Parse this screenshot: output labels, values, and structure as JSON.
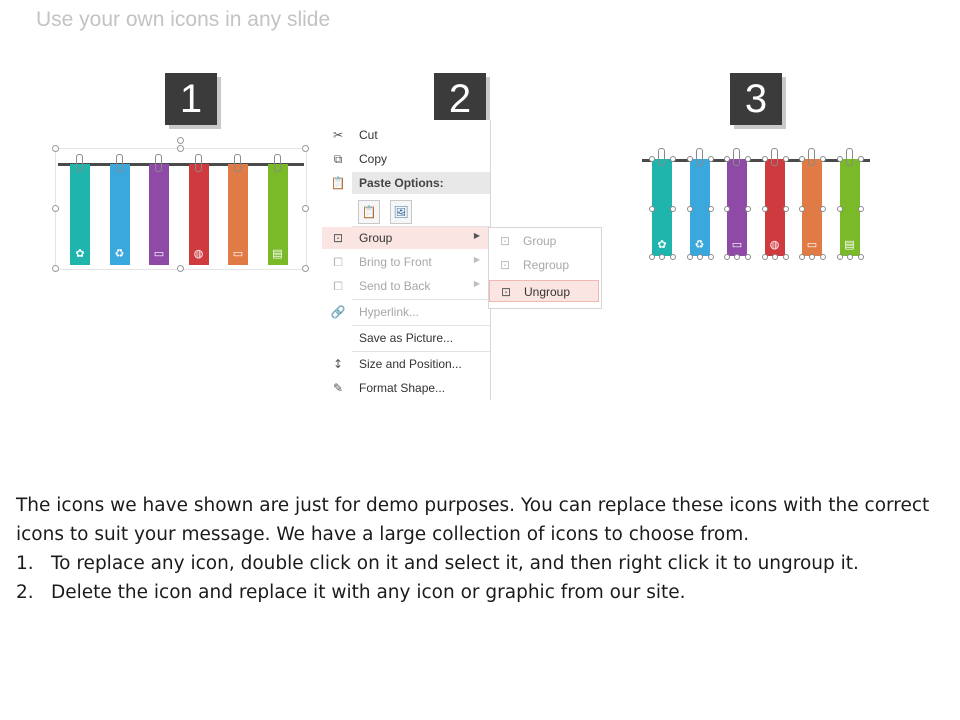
{
  "slide": {
    "title": "Use your own icons in any slide"
  },
  "steps": [
    "1",
    "2",
    "3"
  ],
  "banners": [
    {
      "color": "#1fb5ad",
      "icon": "hand-plant-icon",
      "glyph": "✿"
    },
    {
      "color": "#3aa8dc",
      "icon": "recycle-icon",
      "glyph": "♻"
    },
    {
      "color": "#8e4aa6",
      "icon": "billboard-icon",
      "glyph": "▭"
    },
    {
      "color": "#cf3a3f",
      "icon": "globe-icon",
      "glyph": "◍"
    },
    {
      "color": "#e07b45",
      "icon": "battery-icon",
      "glyph": "▭"
    },
    {
      "color": "#7ab928",
      "icon": "document-icon",
      "glyph": "▤"
    }
  ],
  "context_menu": {
    "items": [
      {
        "label": "Cut",
        "icon": "scissors-icon",
        "glyph": "✂",
        "disabled": false
      },
      {
        "label": "Copy",
        "icon": "copy-icon",
        "glyph": "⧉",
        "disabled": false
      },
      {
        "label": "Paste Options:",
        "icon": "paste-icon",
        "glyph": "📋",
        "disabled": false
      },
      {
        "label": "Group",
        "icon": "group-icon",
        "glyph": "⊡",
        "disabled": false,
        "submenu": true,
        "highlight": true
      },
      {
        "label": "Bring to Front",
        "icon": "bring-to-front-icon",
        "glyph": "⧠",
        "disabled": true,
        "submenu": true
      },
      {
        "label": "Send to Back",
        "icon": "send-to-back-icon",
        "glyph": "⧠",
        "disabled": true,
        "submenu": true
      },
      {
        "label": "Hyperlink...",
        "icon": "hyperlink-icon",
        "glyph": "🔗",
        "disabled": true
      },
      {
        "label": "Save as Picture...",
        "icon": "",
        "glyph": "",
        "disabled": false
      },
      {
        "label": "Size and Position...",
        "icon": "size-position-icon",
        "glyph": "↕",
        "disabled": false
      },
      {
        "label": "Format Shape...",
        "icon": "format-shape-icon",
        "glyph": "✎",
        "disabled": false
      }
    ],
    "paste_options": [
      {
        "icon": "paste-keep-formatting-icon",
        "glyph": "📋"
      },
      {
        "icon": "paste-picture-icon",
        "glyph": "🖼"
      }
    ]
  },
  "submenu": {
    "items": [
      {
        "label": "Group",
        "icon": "group-icon",
        "glyph": "⊡",
        "disabled": true
      },
      {
        "label": "Regroup",
        "icon": "regroup-icon",
        "glyph": "⊡",
        "disabled": true
      },
      {
        "label": "Ungroup",
        "icon": "ungroup-icon",
        "glyph": "⊡",
        "disabled": false,
        "highlight": true
      }
    ]
  },
  "instructions": {
    "intro": "The icons we have shown are just for demo purposes. You can replace these icons with the correct icons to suit your message. We have a large collection of icons to choose from.",
    "steps": [
      {
        "num": "1.",
        "text": "To replace any icon, double click on it and select it, and then right click it to ungroup it."
      },
      {
        "num": "2.",
        "text": "Delete the icon and replace it with any icon or graphic from our site."
      }
    ]
  }
}
